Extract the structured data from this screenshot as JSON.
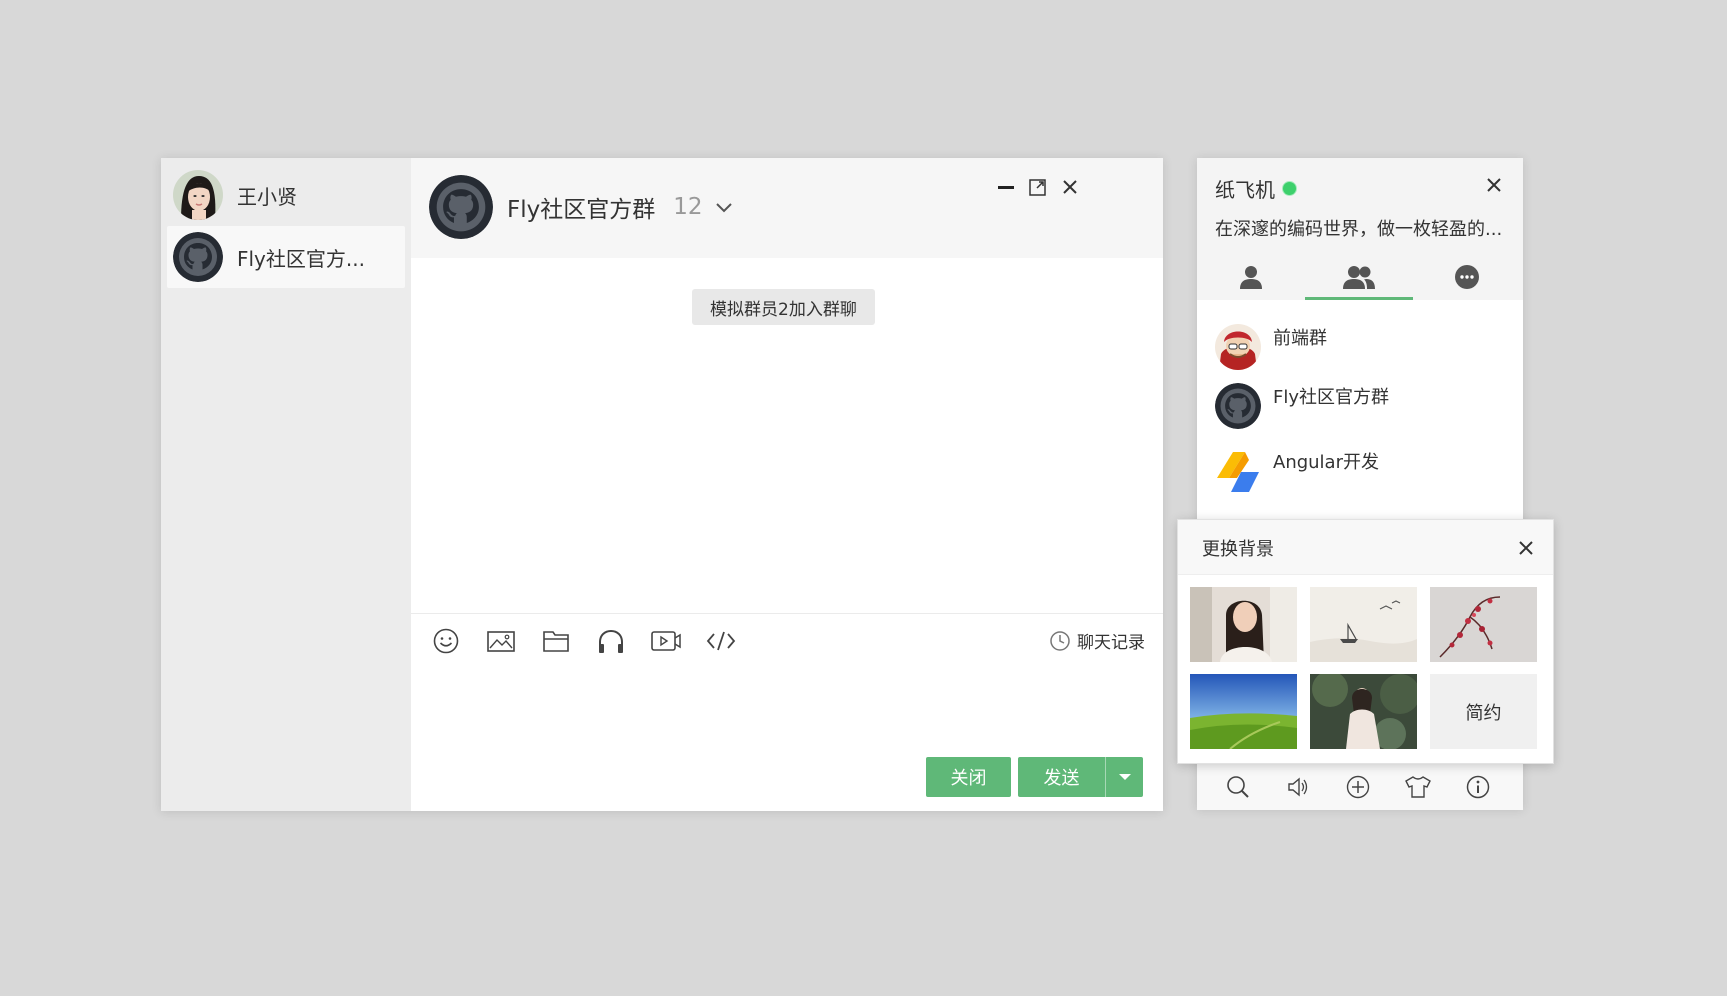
{
  "chat_window": {
    "list": [
      {
        "name": "王小贤",
        "avatar_icon": "female-portrait-avatar"
      },
      {
        "name": "Fly社区官方...",
        "avatar_icon": "github-octocat-avatar",
        "active": true
      }
    ],
    "header": {
      "title": "Fly社区官方群",
      "member_count": "12"
    },
    "system_message": "模拟群员2加入群聊",
    "toolbar": {
      "icons": [
        "smile-icon",
        "image-icon",
        "folder-icon",
        "headphones-icon",
        "video-icon",
        "code-icon"
      ],
      "history_label": "聊天记录"
    },
    "buttons": {
      "close_label": "关闭",
      "send_label": "发送"
    }
  },
  "main_panel": {
    "username": "纸飞机",
    "status": "online",
    "signature": "在深邃的编码世界，做一枚轻盈的...",
    "tabs": [
      {
        "icon": "friend-icon"
      },
      {
        "icon": "group-icon",
        "active": true
      },
      {
        "icon": "history-chat-icon"
      }
    ],
    "groups": [
      {
        "name": "前端群",
        "avatar_icon": "cartoon-avatar"
      },
      {
        "name": "Fly社区官方群",
        "avatar_icon": "github-octocat-avatar"
      },
      {
        "name": "Angular开发",
        "avatar_icon": "angular-logo-avatar"
      }
    ],
    "footer_icons": [
      "search-icon",
      "speaker-icon",
      "add-icon",
      "skin-shirt-icon",
      "info-icon"
    ]
  },
  "skin_popup": {
    "title": "更换背景",
    "thumbnails": [
      "woman-portrait",
      "ink-boat-painting",
      "plum-blossom",
      "green-field-blue-sky",
      "woman-in-forest"
    ],
    "simple_label": "简约"
  },
  "colors": {
    "accent_green": "#5fb878",
    "online_dot": "#3dd06c",
    "page_background": "#d8d8d8",
    "chat_list_background": "#ececec"
  }
}
